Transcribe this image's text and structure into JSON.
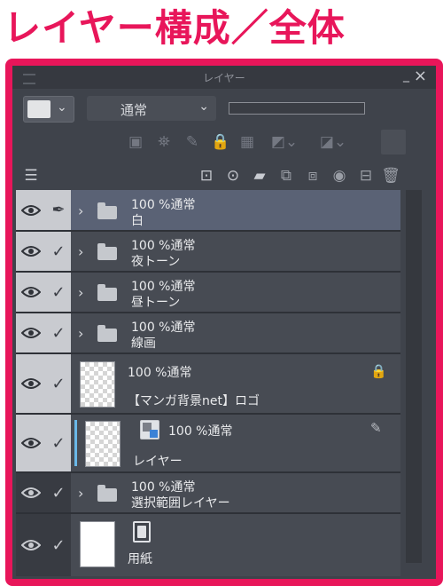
{
  "heading": "レイヤー構成／全体",
  "window": {
    "title": "レイヤー",
    "minimize": "_",
    "close": "×"
  },
  "toolbar": {
    "blend_mode": "通常"
  },
  "layers": [
    {
      "opacity_mode": "100 %通常",
      "name": "白",
      "type": "folder",
      "selected": true,
      "check": "edit"
    },
    {
      "opacity_mode": "100 %通常",
      "name": "夜トーン",
      "type": "folder",
      "check": "check"
    },
    {
      "opacity_mode": "100 %通常",
      "name": "昼トーン",
      "type": "folder",
      "check": "check"
    },
    {
      "opacity_mode": "100 %通常",
      "name": "線画",
      "type": "folder",
      "check": "check"
    },
    {
      "opacity_mode": "100 %通常",
      "name": "【マンガ背景net】ロゴ",
      "type": "raster",
      "locked": true,
      "check": "check"
    },
    {
      "opacity_mode": "100 %通常",
      "name": "レイヤー",
      "type": "raster",
      "check": "check"
    },
    {
      "opacity_mode": "100 %通常",
      "name": "選択範囲レイヤー",
      "type": "folder",
      "check": "check"
    },
    {
      "name": "用紙",
      "type": "paper",
      "check": "check"
    }
  ],
  "icons": {
    "eye": "eye-icon",
    "check": "✓",
    "chevron": "›",
    "lock": "lock-icon",
    "pen": "pen-icon"
  },
  "colors": {
    "accent": "#e8165a",
    "panel": "#3f434b",
    "selected": "#5a6275",
    "sidebar": "#c9cbd0",
    "cursor": "#6ab8e8"
  }
}
